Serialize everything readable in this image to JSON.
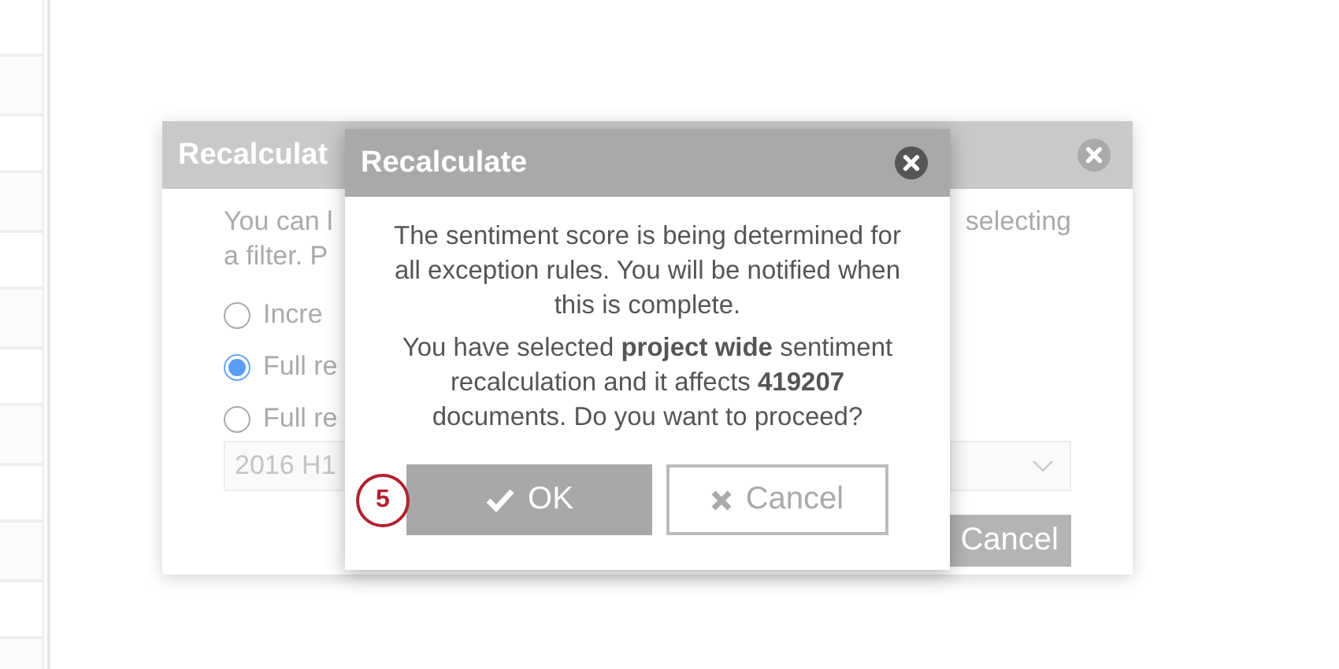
{
  "background_dialog": {
    "title": "Recalculat",
    "text_line_1_start": "You can l",
    "text_line_1_end": "selecting",
    "text_line_2": "a filter. P",
    "options": [
      {
        "label": "Incre",
        "selected": false
      },
      {
        "label": "Full re",
        "selected": true
      },
      {
        "label": "Full re",
        "selected": false
      }
    ],
    "select": {
      "value": "2016 H1"
    },
    "cancel_button": "Cancel"
  },
  "dialog": {
    "title": "Recalculate",
    "message": [
      "The sentiment score is being determined for all exception rules. You will be notified when this is complete.",
      "You have selected **project wide** sentiment recalculation and it affects **419207** documents. Do you want to proceed?"
    ],
    "ok_button": "OK",
    "cancel_button": "Cancel",
    "step_badge": "5"
  }
}
